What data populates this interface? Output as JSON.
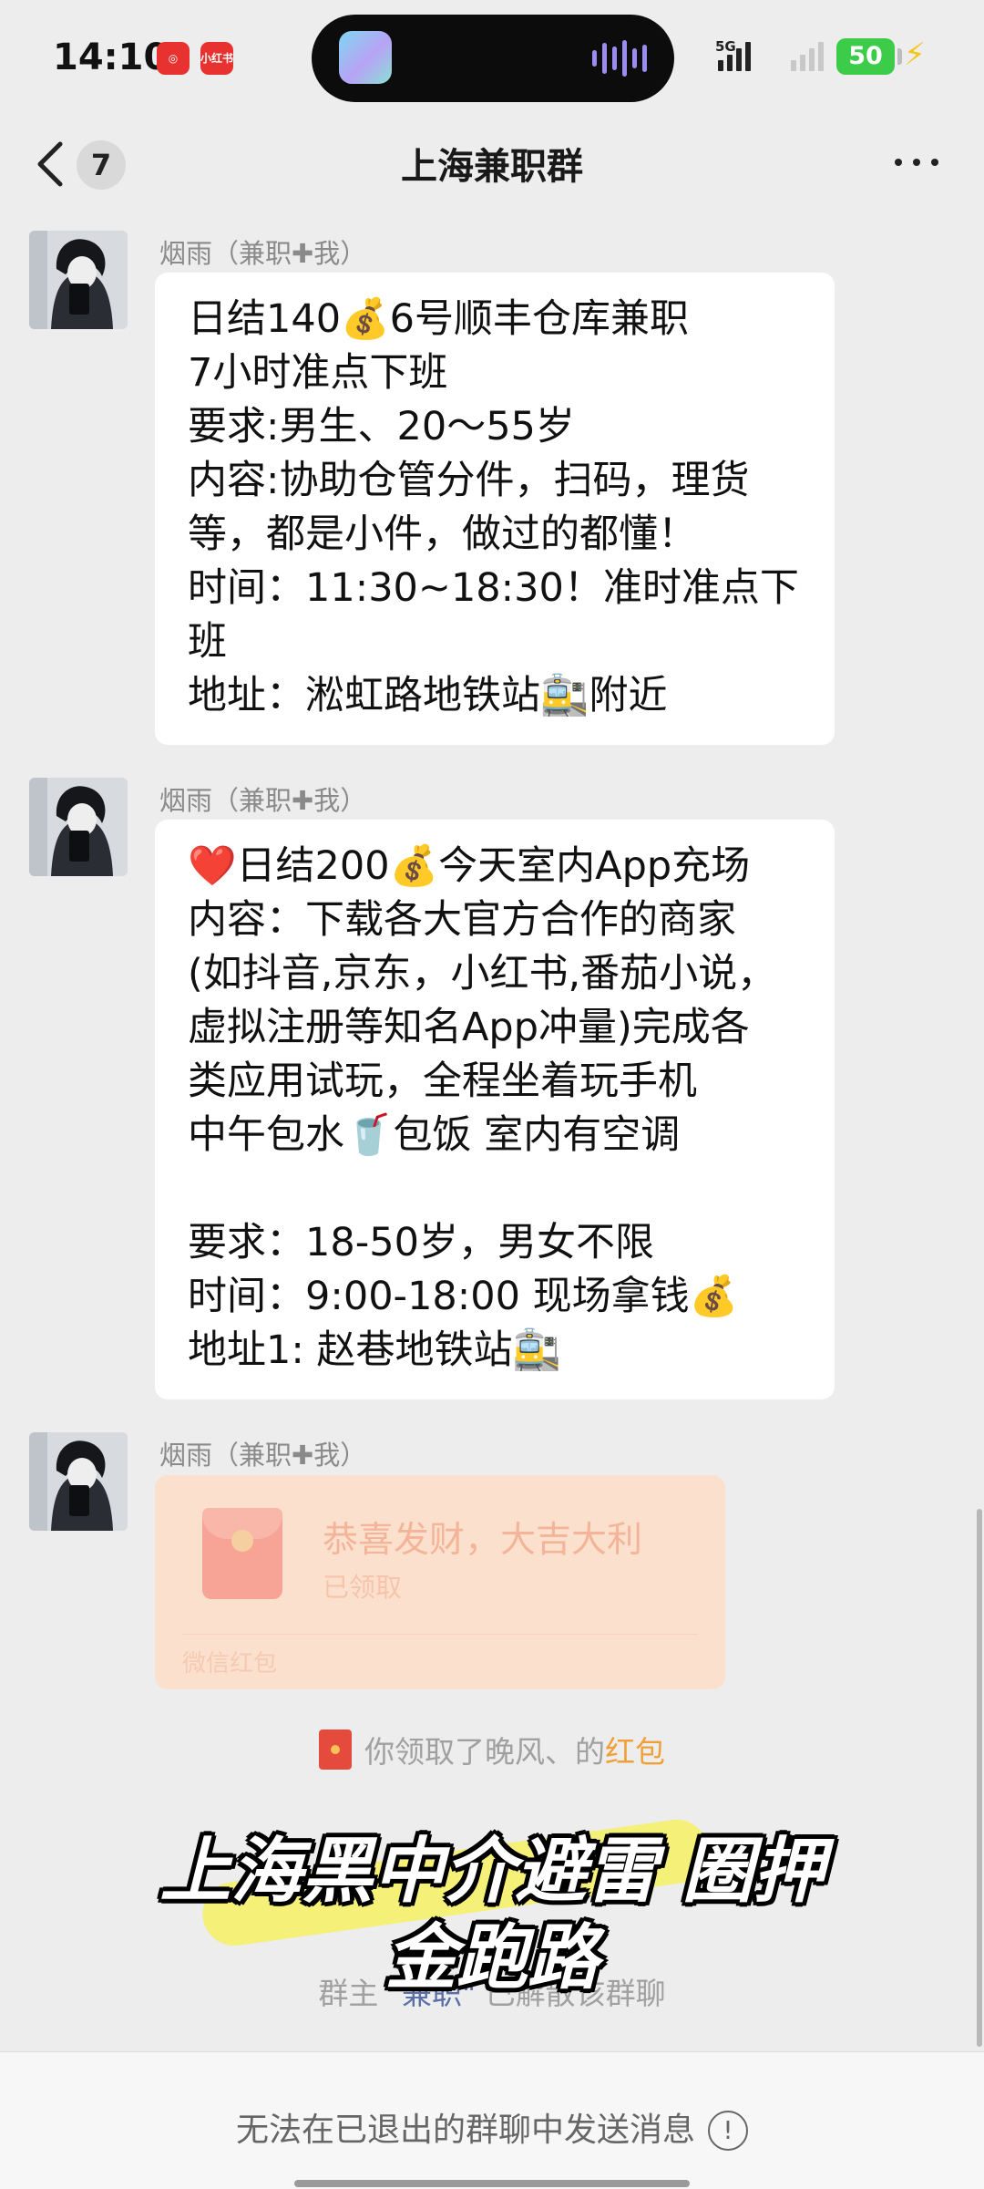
{
  "status_bar": {
    "time": "14:10",
    "app_icons": [
      "netease-music-icon",
      "xiaohongshu-icon"
    ],
    "xiaohongshu_label": "小红书",
    "network": "5G",
    "battery": "50",
    "battery_color": "#3dcc4a"
  },
  "navbar": {
    "unread_count": "7",
    "title": "上海兼职群"
  },
  "messages": [
    {
      "sender": "烟雨（兼职✚我）",
      "lines": [
        "日结140💰6号顺丰仓库兼职",
        "7小时准点下班",
        "要求:男生、20～55岁",
        "内容:协助仓管分件，扫码，理货",
        "等，都是小件，做过的都懂！",
        "时间：11:30~18:30！准时准点下",
        "班",
        "地址：淞虹路地铁站🚉附近"
      ]
    },
    {
      "sender": "烟雨（兼职✚我）",
      "lines": [
        "❤️日结200💰今天室内App充场",
        "内容：下载各大官方合作的商家",
        "(如抖音,京东，小红书,番茄小说，",
        "虚拟注册等知名App冲量)完成各",
        "类应用试玩，全程坐着玩手机",
        "中午包水🥤包饭 室内有空调",
        "",
        "要求：18-50岁，男女不限",
        "时间：9:00-18:00 现场拿钱💰",
        "地址1: 赵巷地铁站🚉"
      ]
    },
    {
      "sender": "烟雨（兼职✚我）",
      "red_packet": {
        "title": "恭喜发财，大吉大利",
        "status": "已领取",
        "footer": "微信红包",
        "color": "#fbe1cd"
      }
    }
  ],
  "system_messages": {
    "received_prefix": "你领取了晚风、的",
    "received_link": "红包",
    "dismissed_prefix": "群主",
    "dismissed_owner": "\"兼职\"",
    "dismissed_suffix": "已解散该群聊"
  },
  "overlay": {
    "line1": "上海黑中介避雷 圈押",
    "line2": "金跑路"
  },
  "bottom_bar": {
    "text": "无法在已退出的群聊中发送消息",
    "info_icon": "!"
  }
}
